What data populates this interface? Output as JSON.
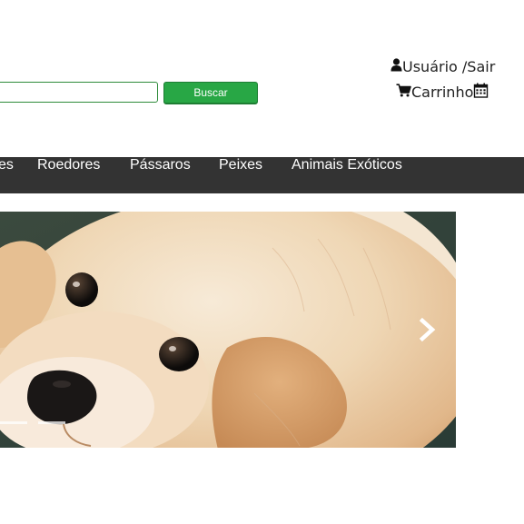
{
  "search": {
    "placeholder": "",
    "value": "",
    "button_label": "Buscar"
  },
  "user_menu": {
    "account_label": "Usuário /Sair",
    "cart_label": "Carrinho",
    "icons": [
      "user-icon",
      "cart-icon",
      "calendar-icon"
    ]
  },
  "nav": {
    "items": [
      {
        "label": "es"
      },
      {
        "label": "Roedores"
      },
      {
        "label": "Pássaros"
      },
      {
        "label": "Peixes"
      },
      {
        "label": "Animais Exóticos"
      }
    ]
  },
  "carousel": {
    "slide_subject": "puppy-photo",
    "controls": [
      "next-arrow-icon"
    ],
    "indicators": 2
  },
  "colors": {
    "accent": "#28a745",
    "navbar": "#333333",
    "text": "#222222"
  }
}
